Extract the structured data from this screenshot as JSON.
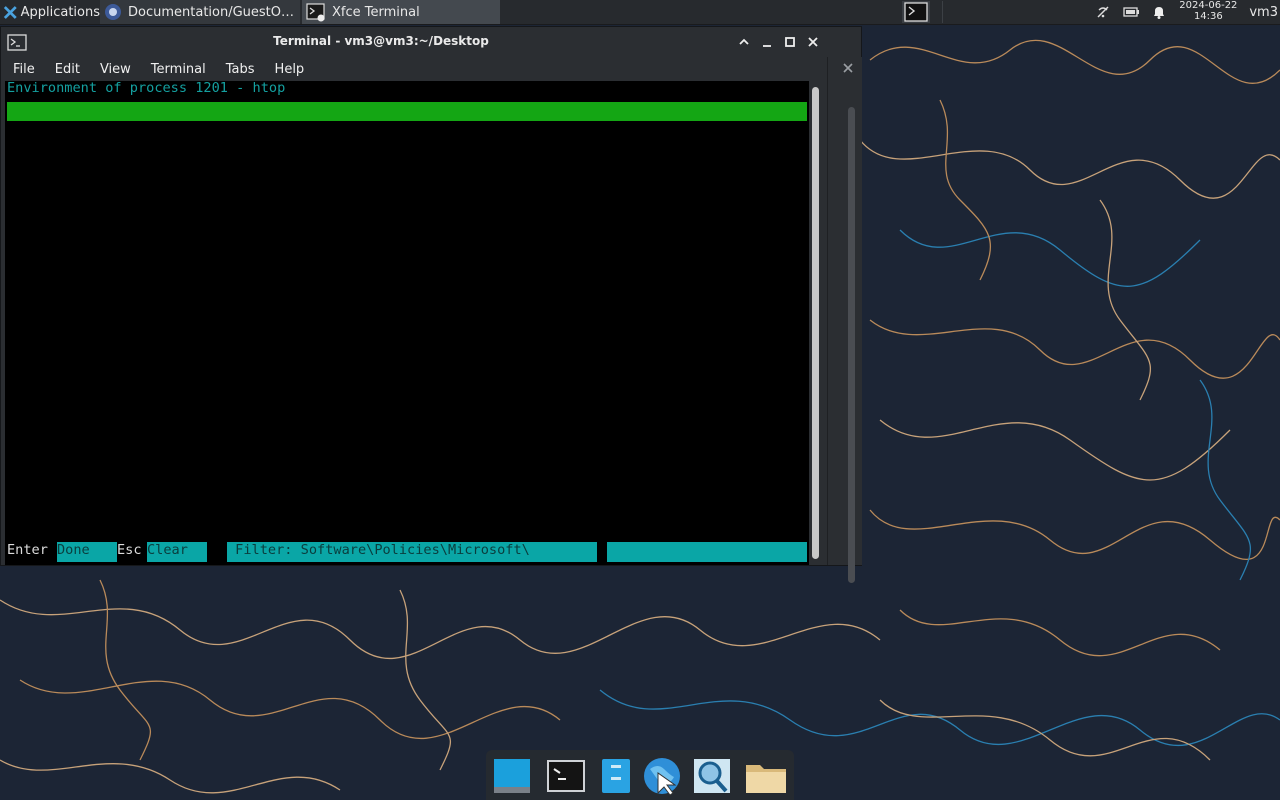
{
  "top_panel": {
    "applications_label": "Applications",
    "tasks": [
      {
        "label": "Documentation/GuestOper…",
        "icon": "browser-icon"
      },
      {
        "label": "Xfce Terminal",
        "icon": "terminal-icon"
      }
    ],
    "clock_date": "2024-06-22",
    "clock_time": "14:36",
    "user": "vm3"
  },
  "terminal_window": {
    "title": "Terminal - vm3@vm3:~/Desktop",
    "menu": [
      "File",
      "Edit",
      "View",
      "Terminal",
      "Tabs",
      "Help"
    ]
  },
  "htop": {
    "title_line": "Environment of process 1201 - htop",
    "footer": {
      "enter_key": "Enter",
      "done_label": "Done  ",
      "esc_key": "Esc",
      "clear_label": "Clear  ",
      "filter_text": " Filter: Software\\Policies\\Microsoft\\"
    }
  },
  "dock": {
    "items": [
      "desktop-icon",
      "terminal-icon",
      "file-manager-icon",
      "web-browser-icon",
      "app-finder-icon",
      "home-folder-icon"
    ]
  },
  "colors": {
    "panel": "#272a2e",
    "htop_green": "#14a614",
    "htop_cyan": "#0aa6a6",
    "wallpaper": "#1c2535"
  }
}
